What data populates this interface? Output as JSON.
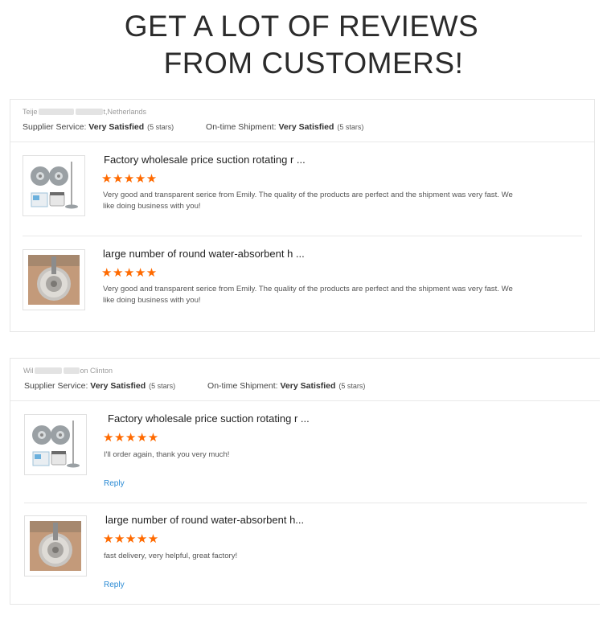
{
  "headline": {
    "line1": "GET A LOT OF REVIEWS",
    "line2": "FROM CUSTOMERS!"
  },
  "reviews": [
    {
      "reviewer_start": "Teije",
      "reviewer_end": "t,Netherlands",
      "supplier_label": "Supplier Service:",
      "supplier_value": "Very Satisfied",
      "supplier_stars": "(5 stars)",
      "shipment_label": "On-time Shipment:",
      "shipment_value": "Very Satisfied",
      "shipment_stars": "(5 stars)",
      "items": [
        {
          "title": "Factory wholesale price suction rotating r ...",
          "stars": "★★★★★",
          "rating": 5,
          "comment": "Very good and transparent serice from Emily. The quality of the products are perfect and the shipment was very fast. We like doing business with you!",
          "image": "mop-set-thumbnail"
        },
        {
          "title": "large number of round water-absorbent h ...",
          "stars": "★★★★★",
          "rating": 5,
          "comment": "Very good and transparent serice from Emily. The quality of the products are perfect and the shipment was very fast. We like doing business with you!",
          "image": "mop-pad-thumbnail"
        }
      ]
    },
    {
      "reviewer_start": "Wil",
      "reviewer_end": "on Clinton",
      "supplier_label": "Supplier Service:",
      "supplier_value": "Very Satisfied",
      "supplier_stars": "(5 stars)",
      "shipment_label": "On-time Shipment:",
      "shipment_value": "Very Satisfied",
      "shipment_stars": "(5 stars)",
      "items": [
        {
          "title": "Factory wholesale price suction rotating r ...",
          "stars": "★★★★★",
          "rating": 5,
          "comment": "I'll order again, thank you very much!",
          "reply": "Reply",
          "image": "mop-set-thumbnail"
        },
        {
          "title": "large number of round water-absorbent h...",
          "stars": "★★★★★",
          "rating": 5,
          "comment": "fast delivery, very helpful, great factory!",
          "reply": "Reply",
          "image": "mop-pad-thumbnail"
        }
      ]
    }
  ],
  "colors": {
    "star": "#ff6a00",
    "reply_link": "#2a8ad4",
    "border": "#e6e6e6"
  }
}
